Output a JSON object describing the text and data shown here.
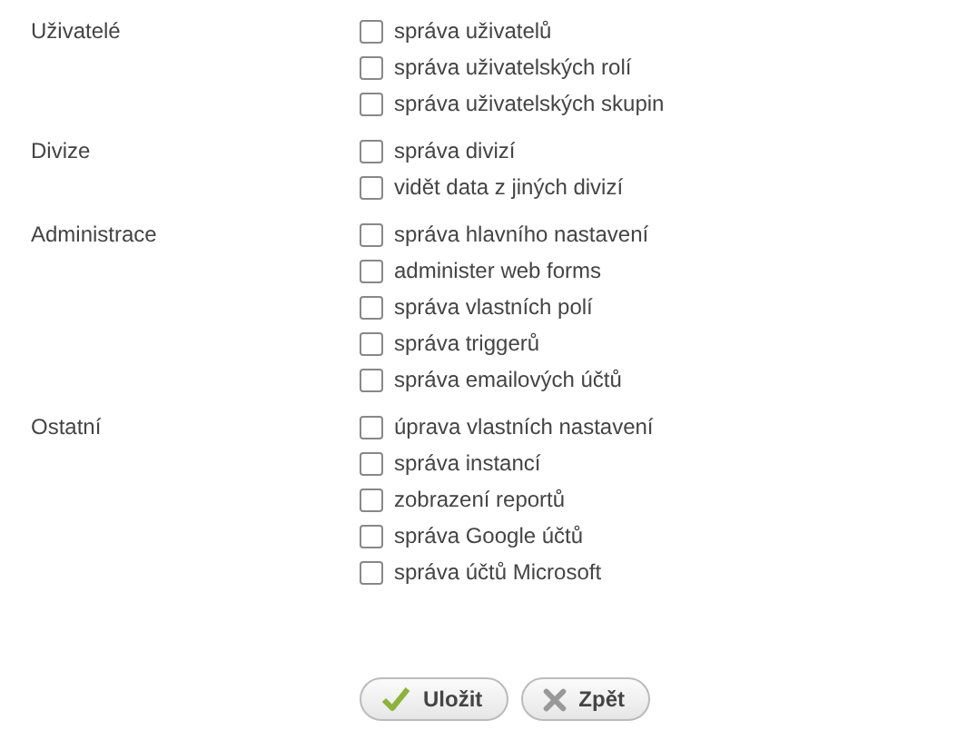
{
  "groups": [
    {
      "label": "Uživatelé",
      "options": [
        {
          "label": "správa uživatelů",
          "checked": false
        },
        {
          "label": "správa uživatelských rolí",
          "checked": false
        },
        {
          "label": "správa uživatelských skupin",
          "checked": false
        }
      ]
    },
    {
      "label": "Divize",
      "options": [
        {
          "label": "správa divizí",
          "checked": false
        },
        {
          "label": "vidět data z jiných divizí",
          "checked": false
        }
      ]
    },
    {
      "label": "Administrace",
      "options": [
        {
          "label": "správa hlavního nastavení",
          "checked": false
        },
        {
          "label": "administer web forms",
          "checked": false
        },
        {
          "label": "správa vlastních polí",
          "checked": false
        },
        {
          "label": "správa triggerů",
          "checked": false
        },
        {
          "label": "správa emailových účtů",
          "checked": false
        }
      ]
    },
    {
      "label": "Ostatní",
      "options": [
        {
          "label": "úprava vlastních nastavení",
          "checked": false
        },
        {
          "label": "správa instancí",
          "checked": false
        },
        {
          "label": "zobrazení reportů",
          "checked": false
        },
        {
          "label": "správa Google účtů",
          "checked": false
        },
        {
          "label": "správa účtů Microsoft",
          "checked": false
        }
      ]
    }
  ],
  "buttons": [
    {
      "label": "Uložit",
      "kind": "save"
    },
    {
      "label": "Zpět",
      "kind": "back"
    }
  ]
}
